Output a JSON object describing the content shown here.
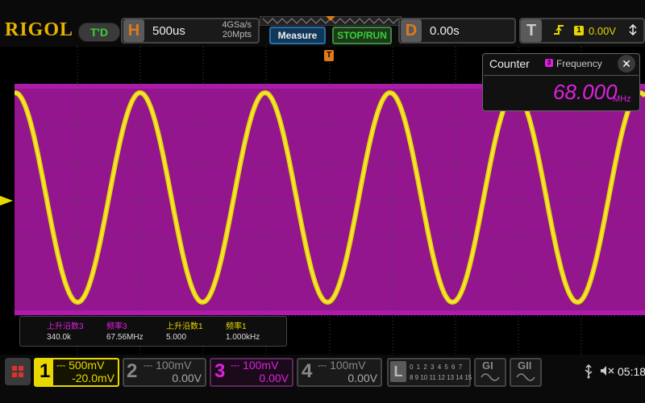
{
  "header": {
    "logo": "RIGOL",
    "mode_badge": "T'D",
    "horizontal": {
      "letter": "H",
      "timebase": "500us",
      "sample_rate": "4GSa/s",
      "memory_depth": "20Mpts"
    },
    "measure_button": "Measure",
    "run_button": "STOP/RUN",
    "delay": {
      "letter": "D",
      "value": "0.00s"
    },
    "trigger": {
      "letter": "T",
      "source": "1",
      "level": "0.00V",
      "edge_icon": "rising-edge-icon"
    }
  },
  "counter": {
    "title": "Counter",
    "source": "3",
    "type": "Frequency",
    "value": "68.000",
    "unit": "MHz"
  },
  "measurements": [
    {
      "label": "上升沿数3",
      "value": "340.0k",
      "color": "#e020e0"
    },
    {
      "label": "频率3",
      "value": "67.56MHz",
      "color": "#e020e0"
    },
    {
      "label": "上升沿数1",
      "value": "5.000",
      "color": "#e8d800"
    },
    {
      "label": "频率1",
      "value": "1.000kHz",
      "color": "#e8d800"
    }
  ],
  "channels": [
    {
      "num": "1",
      "scale": "500mV",
      "offset": "-20.0mV",
      "color": "#e8d800"
    },
    {
      "num": "2",
      "scale": "100mV",
      "offset": "0.00V",
      "color": "#888888"
    },
    {
      "num": "3",
      "scale": "100mV",
      "offset": "0.00V",
      "color": "#e020e0"
    },
    {
      "num": "4",
      "scale": "100mV",
      "offset": "0.00V",
      "color": "#888888"
    }
  ],
  "logic": {
    "letter": "L",
    "row1": "0 1 2 3 4 5 6 7",
    "row2": "8 9 10 11 12 13 14 15"
  },
  "generators": [
    "GI",
    "GII"
  ],
  "status": {
    "clock": "05:18"
  },
  "markers": {
    "trigger_level_channel": "1",
    "trigger_position_letter": "T"
  },
  "colors": {
    "ch1": "#e8d800",
    "ch3": "#e020e0",
    "accent": "#e07a1a"
  }
}
